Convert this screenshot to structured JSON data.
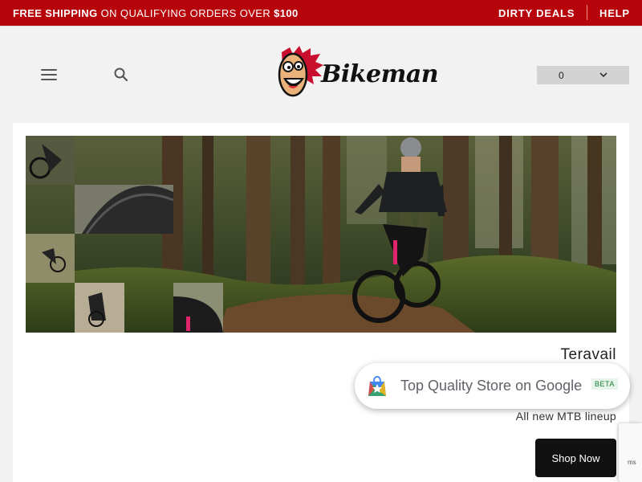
{
  "topbar": {
    "promo_bold_1": "FREE SHIPPING",
    "promo_regular": " ON QUALIFYING ORDERS OVER ",
    "promo_bold_2": "$100",
    "dirty_deals": "DIRTY DEALS",
    "help": "HELP",
    "bg_color": "#b7040b"
  },
  "header": {
    "menu_icon": "hamburger-menu-icon",
    "search_icon": "search-icon",
    "logo_text": "Bikeman",
    "cart": {
      "count": "0",
      "icon": "chevron-down-icon"
    }
  },
  "hero": {
    "brand": "Teravail",
    "subtitle": "All new MTB lineup",
    "cta": "Shop Now"
  },
  "google_badge": {
    "text_main": "Top Quality Store",
    "text_on": " on Google",
    "beta": "BETA"
  },
  "recaptcha": {
    "text": "ms"
  }
}
